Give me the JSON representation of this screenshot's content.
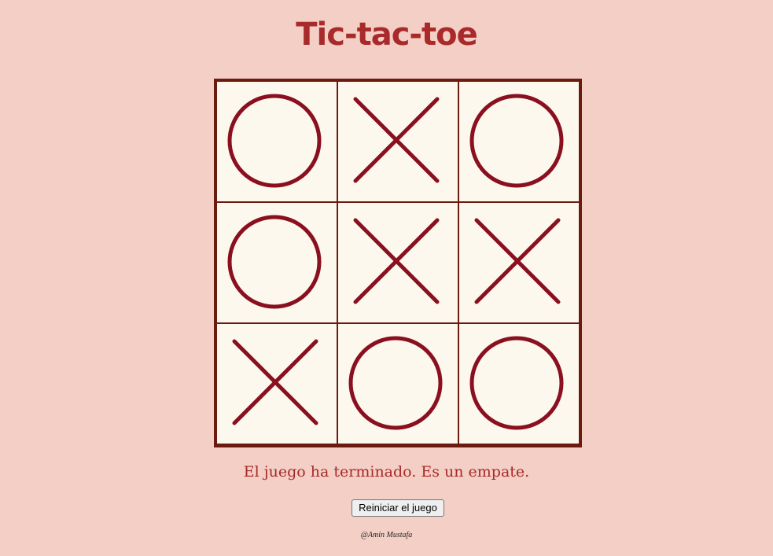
{
  "title": "Tic-tac-toe",
  "board": [
    "O",
    "X",
    "O",
    "O",
    "X",
    "X",
    "X",
    "O",
    "O"
  ],
  "status": "El juego ha terminado. Es un empate.",
  "restart_label": "Reiniciar el juego",
  "credit": "@Amin Mustafa",
  "colors": {
    "background": "#f3cfc6",
    "title": "#a82a2a",
    "mark": "#8a0f1f",
    "board_border": "#6b1a10",
    "cell": "#fcf8ee"
  }
}
